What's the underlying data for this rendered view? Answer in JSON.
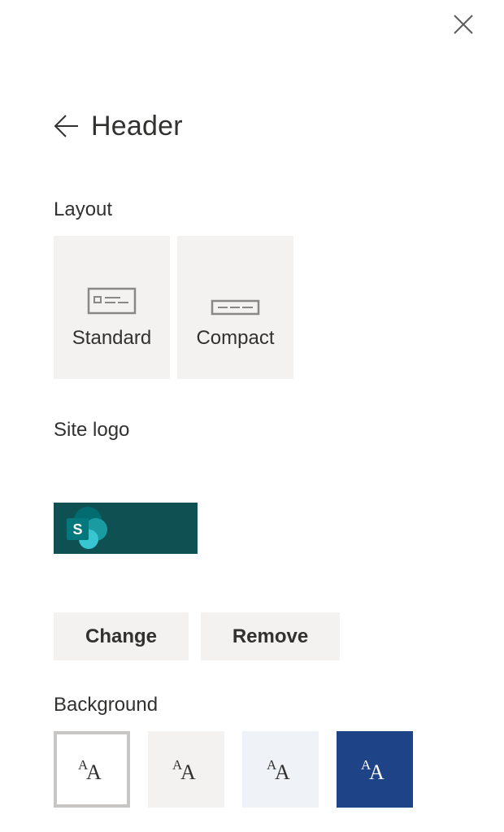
{
  "panel": {
    "title": "Header",
    "close_icon": "close-icon",
    "back_icon": "arrow-left-icon"
  },
  "layout": {
    "label": "Layout",
    "options": [
      {
        "label": "Standard",
        "icon": "header-standard-icon"
      },
      {
        "label": "Compact",
        "icon": "header-compact-icon"
      }
    ]
  },
  "site_logo": {
    "label": "Site logo",
    "logo": "sharepoint-logo",
    "background_color": "#0f5152",
    "change_label": "Change",
    "remove_label": "Remove"
  },
  "background": {
    "label": "Background",
    "swatches": [
      {
        "text_small": "A",
        "text_big": "A",
        "fill": "#ffffff",
        "text_color": "#323130",
        "selected": true
      },
      {
        "text_small": "A",
        "text_big": "A",
        "fill": "#f3f2f1",
        "text_color": "#323130",
        "selected": false
      },
      {
        "text_small": "A",
        "text_big": "A",
        "fill": "#eff3f8",
        "text_color": "#323130",
        "selected": false
      },
      {
        "text_small": "A",
        "text_big": "A",
        "fill": "#1e4387",
        "text_color": "#ffffff",
        "selected": false
      }
    ]
  }
}
